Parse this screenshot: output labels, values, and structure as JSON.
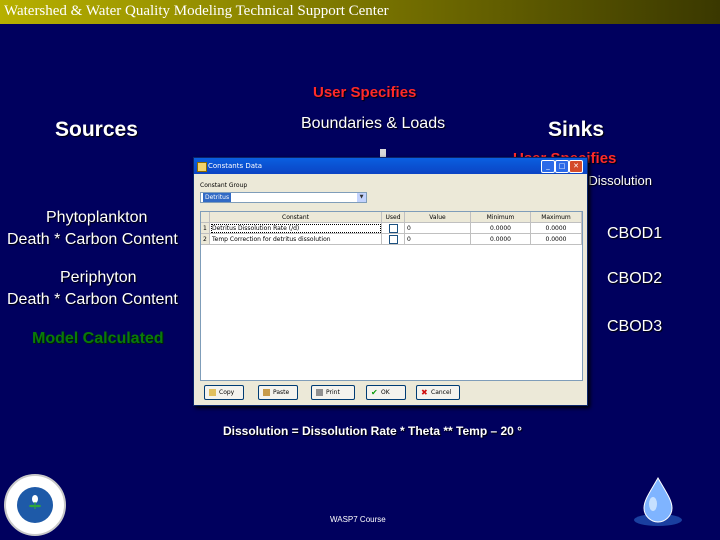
{
  "header": {
    "title": "Watershed & Water Quality Modeling Technical Support Center"
  },
  "slide": {
    "user_specifies_top": "User Specifies",
    "boundaries_loads": "Boundaries & Loads",
    "sources_title": "Sources",
    "sinks_title": "Sinks",
    "user_specifies_sinks": "User Specifies",
    "detritus_dissolution": "Detritus Dissolution",
    "phytoplankton_line1": "Phytoplankton",
    "phytoplankton_line2": "Death * Carbon Content",
    "periphyton_line1": "Periphyton",
    "periphyton_line2": "Death * Carbon Content",
    "model_calculated": "Model Calculated",
    "cbod1": "CBOD1",
    "cbod2": "CBOD2",
    "cbod3": "CBOD3",
    "equation": "Dissolution = Dissolution Rate * Theta ** Temp – 20 °",
    "footer": "WASP7 Course",
    "colors": {
      "red_label": "#ff2a2a",
      "green_label": "#0a7a0a",
      "background": "#00005e"
    }
  },
  "dialog": {
    "title": "Constants Data",
    "constant_group_label": "Constant Group",
    "constant_group_value": "Detritus",
    "columns": [
      "Constant",
      "Used",
      "Value",
      "Minimum",
      "Maximum"
    ],
    "rows": [
      {
        "num": "1",
        "constant": "Detritus Dissolution Rate (/d)",
        "used": false,
        "value": "0",
        "minimum": "0.0000",
        "maximum": "0.0000"
      },
      {
        "num": "2",
        "constant": "Temp Correction for detritus dissolution",
        "used": false,
        "value": "0",
        "minimum": "0.0000",
        "maximum": "0.0000"
      }
    ],
    "buttons": {
      "copy": "Copy",
      "paste": "Paste",
      "print": "Print",
      "ok": "OK",
      "cancel": "Cancel"
    }
  }
}
